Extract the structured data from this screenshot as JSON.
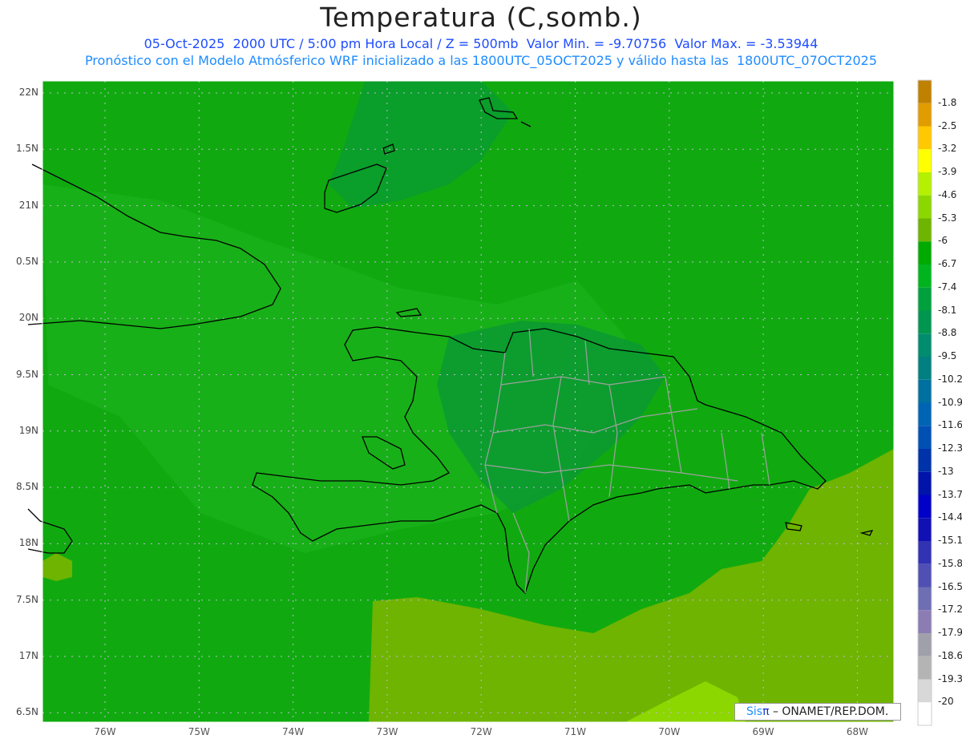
{
  "header": {
    "title": "Temperatura (C,somb.)",
    "line1": "05-Oct-2025  2000 UTC / 5:00 pm Hora Local / Z = 500mb  Valor Min. = -9.70756  Valor Max. = -3.53944",
    "line2": "Pronóstico con el Modelo Atmósferico WRF inicializado a las 1800UTC_05OCT2025 y válido hasta las  1800UTC_07OCT2025"
  },
  "axes": {
    "lat_labels": [
      "22N",
      "1.5N",
      "21N",
      "0.5N",
      "20N",
      "9.5N",
      "19N",
      "8.5N",
      "18N",
      "7.5N",
      "17N",
      "6.5N"
    ],
    "lon_labels": [
      "76W",
      "75W",
      "74W",
      "73W",
      "72W",
      "71W",
      "70W",
      "69W",
      "68W"
    ]
  },
  "colorbar": {
    "labels": [
      "-1.8",
      "-2.5",
      "-3.2",
      "-3.9",
      "-4.6",
      "-5.3",
      "-6",
      "-6.7",
      "-7.4",
      "-8.1",
      "-8.8",
      "-9.5",
      "-10.2",
      "-10.9",
      "-11.6",
      "-12.3",
      "-13",
      "-13.7",
      "-14.4",
      "-15.1",
      "-15.8",
      "-16.5",
      "-17.2",
      "-17.9",
      "-18.6",
      "-19.3",
      "-20"
    ],
    "colors": [
      "#c08000",
      "#e09c00",
      "#ffc800",
      "#ffff00",
      "#b4f000",
      "#8cd700",
      "#6eb400",
      "#00aa00",
      "#00b41e",
      "#00a03c",
      "#009650",
      "#008c6e",
      "#008080",
      "#0070a0",
      "#0064b4",
      "#0050b4",
      "#0032aa",
      "#0014aa",
      "#0000c8",
      "#1010b4",
      "#3232b4",
      "#5050b4",
      "#6e6eb4",
      "#8c7cb4",
      "#a0a0aa",
      "#b4b4b4",
      "#d8d8d8",
      "#ffffff"
    ]
  },
  "credit": {
    "sis": "Sis",
    "pi": "π",
    "text": " – ONAMET/REP.DOM."
  }
}
